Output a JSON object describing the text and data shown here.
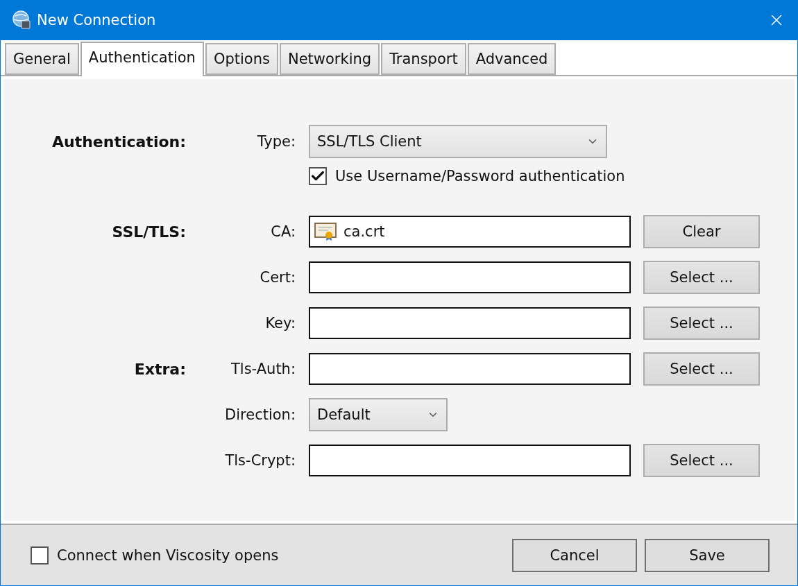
{
  "window": {
    "title": "New Connection"
  },
  "tabs": [
    {
      "label": "General",
      "selected": false
    },
    {
      "label": "Authentication",
      "selected": true
    },
    {
      "label": "Options",
      "selected": false
    },
    {
      "label": "Networking",
      "selected": false
    },
    {
      "label": "Transport",
      "selected": false
    },
    {
      "label": "Advanced",
      "selected": false
    }
  ],
  "rows": [
    {
      "kind": "select",
      "section": "Authentication:",
      "label": "Type:",
      "value": "SSL/TLS Client"
    },
    {
      "kind": "checkbox",
      "label": "Use Username/Password authentication",
      "checked": true
    },
    {
      "kind": "file",
      "section": "SSL/TLS:",
      "label": "CA:",
      "value": "ca.crt",
      "has_file": true,
      "button": "Clear"
    },
    {
      "kind": "file",
      "label": "Cert:",
      "has_file": false,
      "button": "Select ..."
    },
    {
      "kind": "file",
      "label": "Key:",
      "has_file": false,
      "button": "Select ..."
    },
    {
      "kind": "file",
      "section": "Extra:",
      "label": "Tls-Auth:",
      "has_file": false,
      "button": "Select ..."
    },
    {
      "kind": "dropdown",
      "label": "Direction:",
      "value": "Default"
    },
    {
      "kind": "file",
      "label": "Tls-Crypt:",
      "has_file": false,
      "button": "Select ..."
    }
  ],
  "footer": {
    "connect_on_open": {
      "label": "Connect when Viscosity opens",
      "checked": false
    },
    "buttons": [
      "Cancel",
      "Save"
    ]
  }
}
